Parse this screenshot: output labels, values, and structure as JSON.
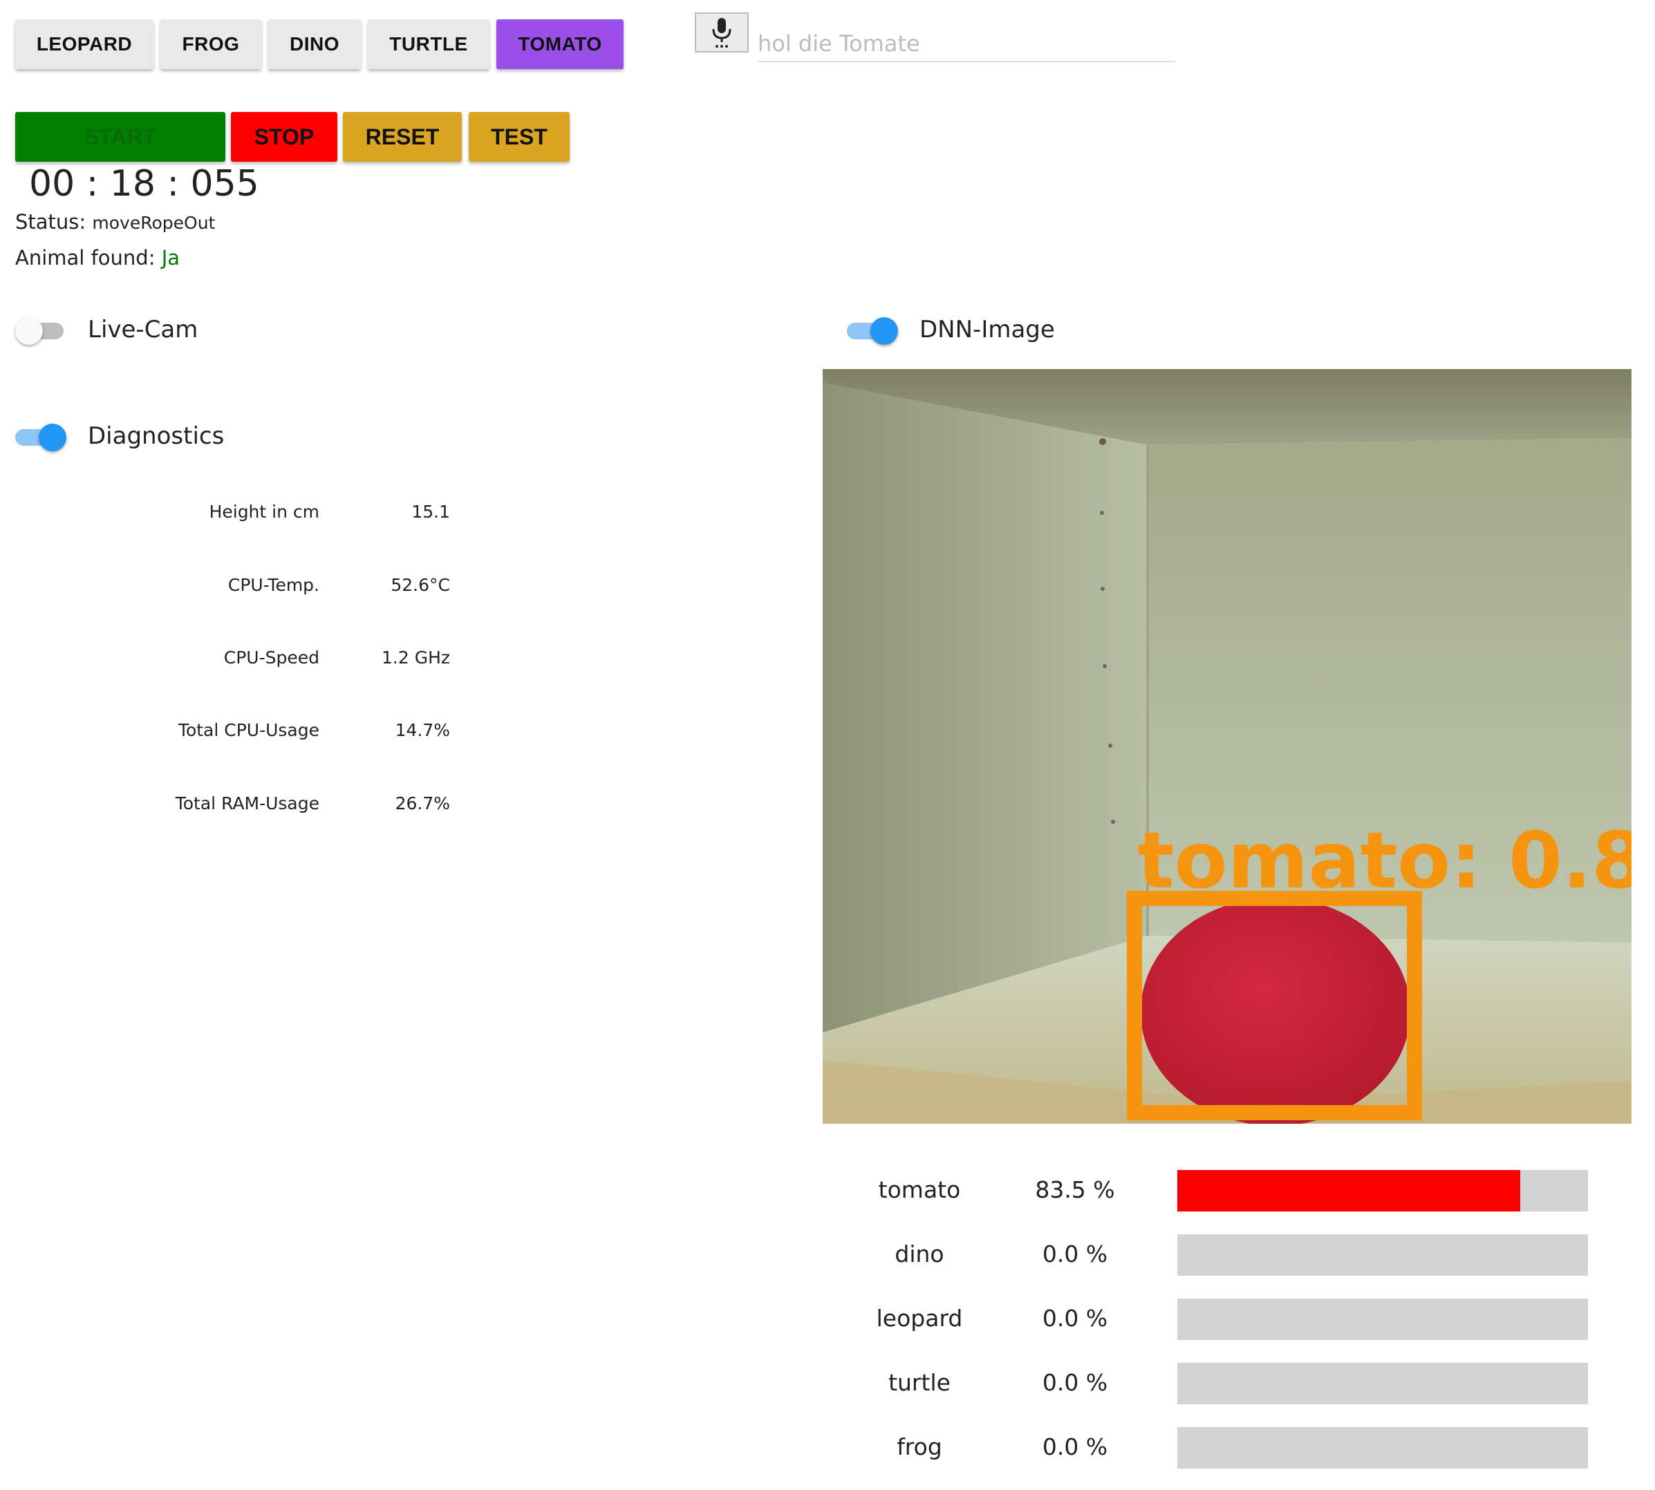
{
  "targets": [
    {
      "label": "LEOPARD",
      "selected": false
    },
    {
      "label": "FROG",
      "selected": false
    },
    {
      "label": "DINO",
      "selected": false
    },
    {
      "label": "TURTLE",
      "selected": false
    },
    {
      "label": "TOMATO",
      "selected": true
    }
  ],
  "speech": {
    "placeholder": "hol die Tomate",
    "mic_icon": "microphone-icon"
  },
  "controls": {
    "start_label": "START",
    "stop_label": "STOP",
    "reset_label": "RESET",
    "test_label": "TEST",
    "colors": {
      "start": "#008000",
      "stop": "#ff0000",
      "reset": "#daa520",
      "test": "#daa520"
    }
  },
  "timer": "00 : 18 : 055",
  "status": {
    "label": "Status:",
    "value": "moveRopeOut"
  },
  "animal_found": {
    "label": "Animal found:",
    "value": "Ja",
    "color": "#008000"
  },
  "toggles": {
    "live_cam": {
      "label": "Live-Cam",
      "on": false
    },
    "dnn_image": {
      "label": "DNN-Image",
      "on": true
    },
    "diagnostics": {
      "label": "Diagnostics",
      "on": true
    }
  },
  "diagnostics": [
    {
      "label": "Height in cm",
      "value": "15.1"
    },
    {
      "label": "CPU-Temp.",
      "value": "52.6°C"
    },
    {
      "label": "CPU-Speed",
      "value": "1.2 GHz"
    },
    {
      "label": "Total CPU-Usage",
      "value": "14.7%"
    },
    {
      "label": "Total RAM-Usage",
      "value": "26.7%"
    }
  ],
  "dnn": {
    "detection_label": "tomato: 0.8",
    "box_color": "#f5950f",
    "object": "tomato"
  },
  "predictions": [
    {
      "label": "tomato",
      "percent_text": "83.5 %",
      "percent": 83.5
    },
    {
      "label": "dino",
      "percent_text": "0.0 %",
      "percent": 0.0
    },
    {
      "label": "leopard",
      "percent_text": "0.0 %",
      "percent": 0.0
    },
    {
      "label": "turtle",
      "percent_text": "0.0 %",
      "percent": 0.0
    },
    {
      "label": "frog",
      "percent_text": "0.0 %",
      "percent": 0.0
    }
  ]
}
